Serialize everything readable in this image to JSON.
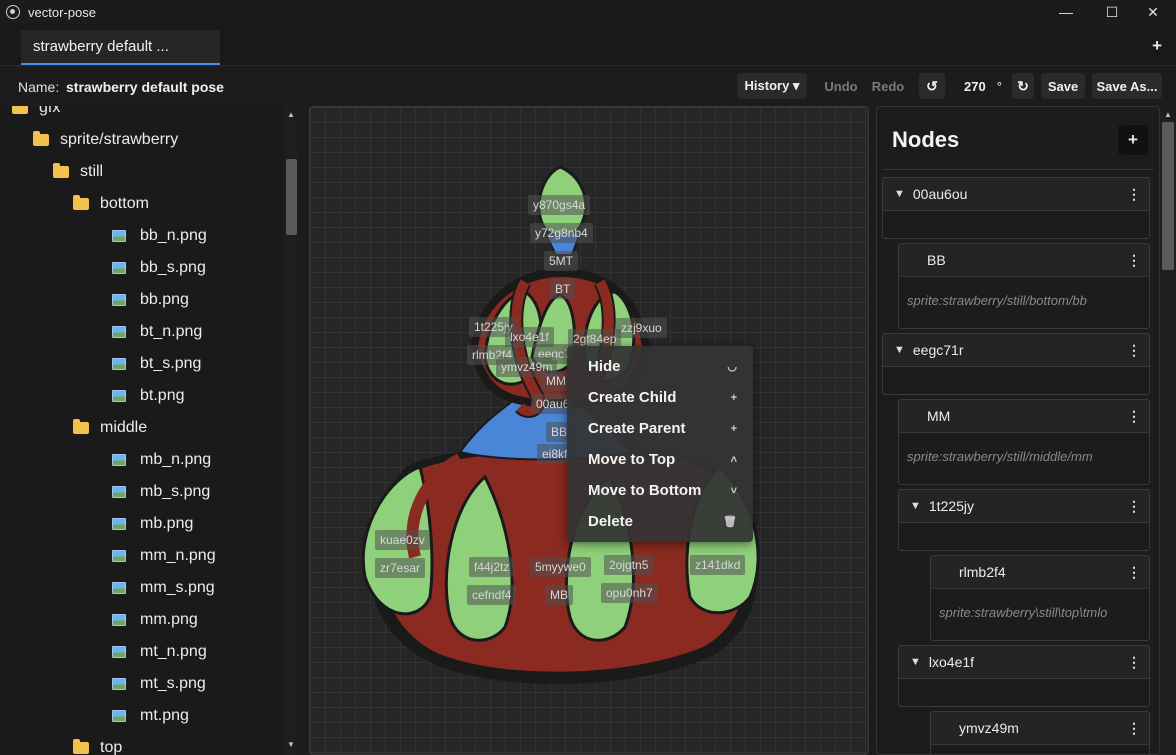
{
  "app": {
    "title": "vector-pose"
  },
  "window": {
    "minimize": "—",
    "maximize": "☐",
    "close": "✕"
  },
  "tabs": [
    {
      "label": "strawberry default ..."
    }
  ],
  "tab_add": "+",
  "toolbar": {
    "name_label": "Name:",
    "name_value": "strawberry default pose",
    "history": "History ▾",
    "undo": "Undo",
    "redo": "Redo",
    "rotate_left": "↺",
    "rotation": "270",
    "degree": "°",
    "rotate_right": "↻",
    "save": "Save",
    "save_as": "Save As..."
  },
  "tree": {
    "items": [
      {
        "label": "gfx",
        "type": "folder"
      },
      {
        "label": "sprite/strawberry",
        "type": "folder"
      },
      {
        "label": "still",
        "type": "folder"
      },
      {
        "label": "bottom",
        "type": "folder"
      },
      {
        "label": "bb_n.png",
        "type": "file"
      },
      {
        "label": "bb_s.png",
        "type": "file"
      },
      {
        "label": "bb.png",
        "type": "file"
      },
      {
        "label": "bt_n.png",
        "type": "file"
      },
      {
        "label": "bt_s.png",
        "type": "file"
      },
      {
        "label": "bt.png",
        "type": "file"
      },
      {
        "label": "middle",
        "type": "folder"
      },
      {
        "label": "mb_n.png",
        "type": "file"
      },
      {
        "label": "mb_s.png",
        "type": "file"
      },
      {
        "label": "mb.png",
        "type": "file"
      },
      {
        "label": "mm_n.png",
        "type": "file"
      },
      {
        "label": "mm_s.png",
        "type": "file"
      },
      {
        "label": "mm.png",
        "type": "file"
      },
      {
        "label": "mt_n.png",
        "type": "file"
      },
      {
        "label": "mt_s.png",
        "type": "file"
      },
      {
        "label": "mt.png",
        "type": "file"
      },
      {
        "label": "top",
        "type": "folder"
      }
    ]
  },
  "canvas": {
    "tags": [
      "y870gs4a",
      "y72g8nb4",
      "5MT",
      "BT",
      "1t225jy",
      "lxo4e1f",
      "2gt84ep",
      "zzj9xuo",
      "rlmb2f4",
      "eegc7",
      "ymvz49m",
      "MM",
      "00au6",
      "BB",
      "ei8kf",
      "kuae0zv",
      "zr7esar",
      "f44j2tz",
      "cefndf4",
      "5myywe0",
      "MB",
      "2ojgtn5",
      "opu0nh7",
      "z141dkd"
    ]
  },
  "context_menu": {
    "items": [
      {
        "label": "Hide",
        "key": "◡"
      },
      {
        "label": "Create Child",
        "key": "+"
      },
      {
        "label": "Create Parent",
        "key": "+"
      },
      {
        "label": "Move to Top",
        "key": "˄"
      },
      {
        "label": "Move to Bottom",
        "key": "˅"
      },
      {
        "label": "Delete",
        "key": "🗑"
      }
    ]
  },
  "nodes_panel": {
    "title": "Nodes",
    "add": "+",
    "menu": "⋮",
    "expanded": "▼",
    "nodes": [
      {
        "name": "00au6ou"
      },
      {
        "name": "BB",
        "path": "sprite:strawberry/still/bottom/bb"
      },
      {
        "name": "eegc71r"
      },
      {
        "name": "MM",
        "path": "sprite:strawberry/still/middle/mm"
      },
      {
        "name": "1t225jy"
      },
      {
        "name": "rlmb2f4",
        "path": "sprite:strawberry\\still\\top\\tmlo"
      },
      {
        "name": "lxo4e1f"
      },
      {
        "name": "ymvz49m"
      }
    ]
  }
}
